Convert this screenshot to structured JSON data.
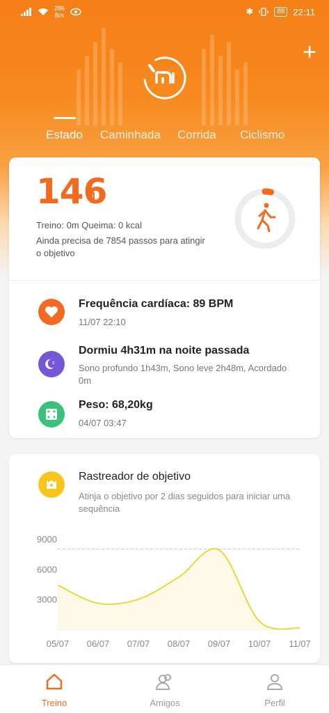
{
  "statusbar": {
    "net_speed_value": "286",
    "net_speed_unit": "B/s",
    "battery": "88",
    "time": "22:11"
  },
  "header": {
    "tabs": [
      {
        "label": "Estado",
        "active": true
      },
      {
        "label": "Caminhada",
        "active": false
      },
      {
        "label": "Corrida",
        "active": false
      },
      {
        "label": "Ciclismo",
        "active": false
      }
    ]
  },
  "summary": {
    "steps": "146",
    "workout_line": "Treino: 0m Queima: 0 kcal",
    "goal_line": "Ainda precisa de 7854 passos para atingir o objetivo",
    "goal_progress": 0.0183
  },
  "metrics": [
    {
      "icon": "heart-icon",
      "color": "#f26a22",
      "title": "Frequência cardíaca: 89 BPM",
      "subtitle": "11/07 22:10"
    },
    {
      "icon": "moon-icon",
      "color": "#7457d8",
      "title": "Dormiu 4h31m na noite passada",
      "subtitle": "Sono profundo 1h43m, Sono leve 2h48m, Acordado 0m"
    },
    {
      "icon": "scale-icon",
      "color": "#3ac27a",
      "title": "Peso: 68,20kg",
      "subtitle": "04/07 03:47"
    }
  ],
  "goal_tracker": {
    "title": "Rastreador de objetivo",
    "subtitle": "Atinja o objetivo por 2 dias seguidos para iniciar uma sequência",
    "icon_color": "#f8c51d"
  },
  "chart_data": {
    "type": "line",
    "x": [
      "05/07",
      "06/07",
      "07/07",
      "08/07",
      "09/07",
      "10/07",
      "11/07"
    ],
    "values": [
      4400,
      2600,
      3000,
      5200,
      7900,
      800,
      146
    ],
    "ylim": [
      0,
      9000
    ],
    "yticks": [
      "9000",
      "6000",
      "3000"
    ],
    "goal_line": 8000,
    "line_color": "#e6d93a",
    "grid": false
  },
  "bottom_nav": [
    {
      "label": "Treino",
      "icon": "treino-icon",
      "active": true
    },
    {
      "label": "Amigos",
      "icon": "friends-icon",
      "active": false
    },
    {
      "label": "Perfil",
      "icon": "profile-icon",
      "active": false
    }
  ],
  "colors": {
    "accent": "#f16a1d",
    "hero": "#f57f17"
  }
}
